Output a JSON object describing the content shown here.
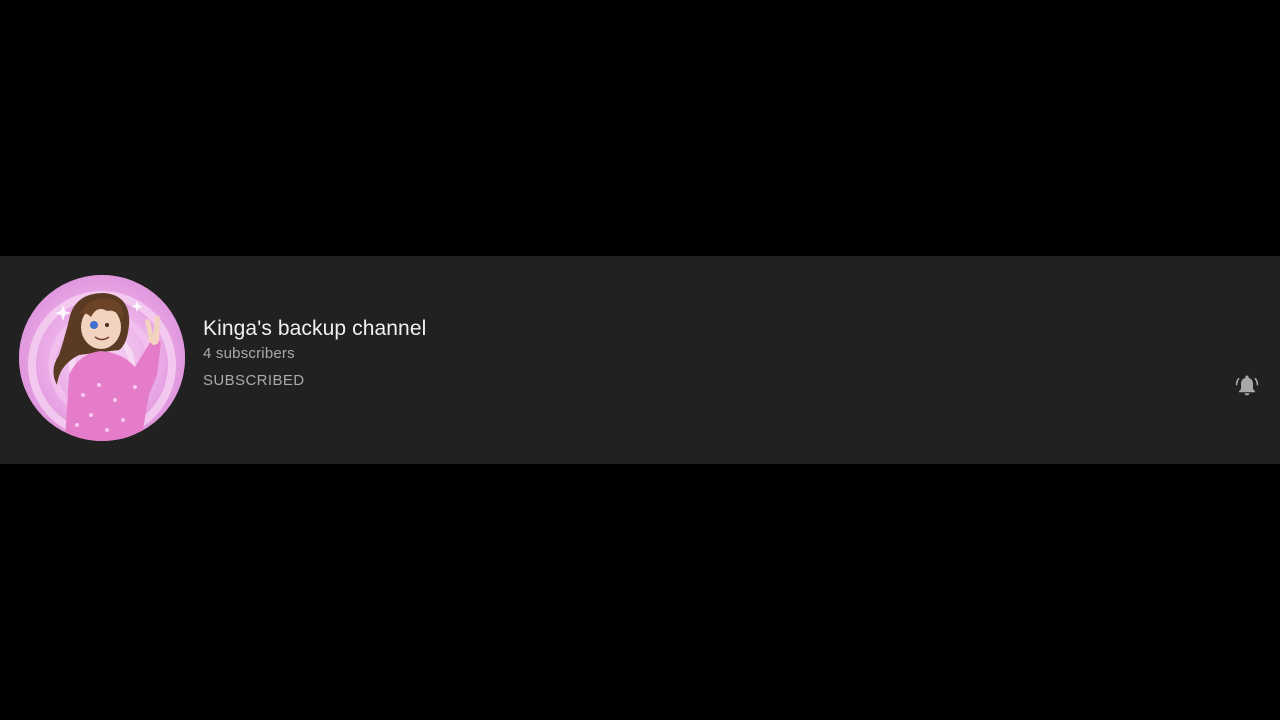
{
  "channel": {
    "name": "Kinga's backup channel",
    "subscribers": "4 subscribers",
    "subscribe_state": "SUBSCRIBED",
    "avatar_icon": "channel-avatar-illustration",
    "notification_icon": "bell-ringing-icon"
  },
  "colors": {
    "page_background": "#000000",
    "card_background": "#212121",
    "title_text": "#f1f1f1",
    "secondary_text": "#aaaaaa",
    "avatar_pink": "#e6a6e6"
  }
}
